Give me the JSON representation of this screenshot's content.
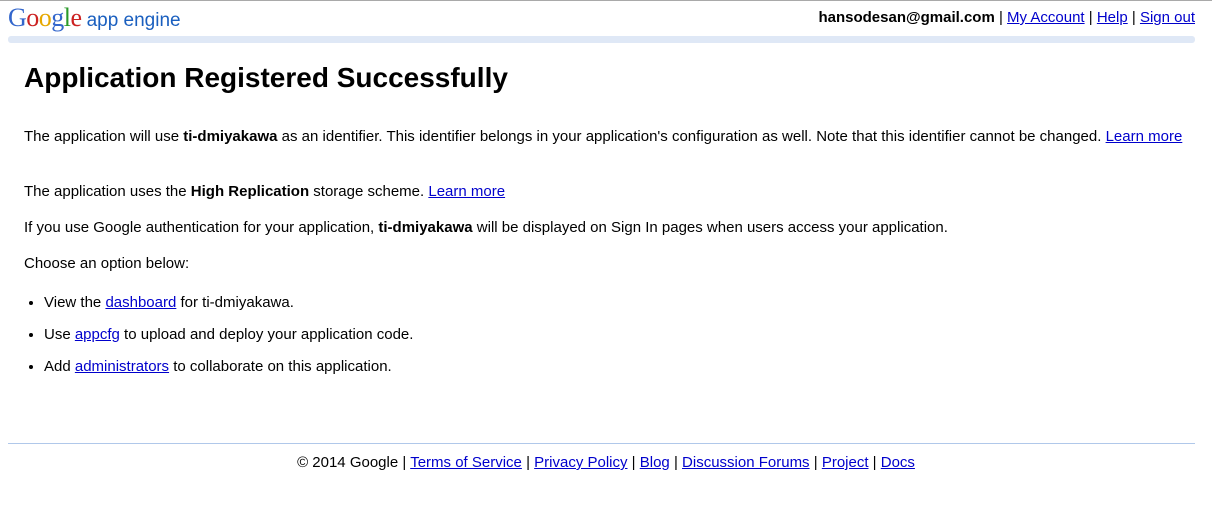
{
  "header": {
    "logo_letters": [
      "G",
      "o",
      "o",
      "g",
      "l",
      "e"
    ],
    "product": "app engine",
    "email": "hansodesan@gmail.com",
    "my_account": "My Account",
    "help": "Help",
    "sign_out": "Sign out",
    "separator": "|"
  },
  "page_title": "Application Registered Successfully",
  "body": {
    "p1_pre": "The application will use ",
    "app_id": "ti-dmiyakawa",
    "p1_post": " as an identifier. This identifier belongs in your application's configuration as well. Note that this identifier cannot be changed. ",
    "learn_more": "Learn more",
    "p2_pre": "The application uses the ",
    "storage": "High Replication",
    "p2_post": " storage scheme. ",
    "p3_pre": "If you use Google authentication for your application, ",
    "p3_post": " will be displayed on Sign In pages when users access your application.",
    "p4": "Choose an option below:"
  },
  "options": [
    {
      "pre": "View the ",
      "link": "dashboard",
      "post": " for ti-dmiyakawa."
    },
    {
      "pre": "Use ",
      "link": "appcfg",
      "post": " to upload and deploy your application code."
    },
    {
      "pre": "Add ",
      "link": "administrators",
      "post": " to collaborate on this application."
    }
  ],
  "footer": {
    "copyright": "© 2014 Google",
    "links": [
      "Terms of Service",
      "Privacy Policy",
      "Blog",
      "Discussion Forums",
      "Project",
      "Docs"
    ],
    "separator": "|"
  },
  "colors": {
    "link": "#0000cc",
    "header_bar": "#dfe8f6",
    "footer_rule": "#b0c8ea",
    "logo_blue": "#3366cc",
    "logo_red": "#cc2222",
    "logo_yellow": "#e6a800",
    "logo_green": "#2a9a2a",
    "product_text": "#1a5fbf"
  }
}
